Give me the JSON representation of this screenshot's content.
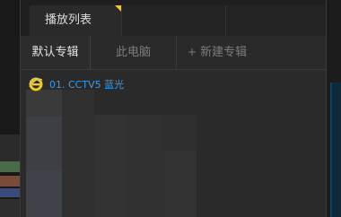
{
  "header": {
    "tab_label": "播放列表"
  },
  "subtabs": {
    "default_album": "默认专辑",
    "this_computer": "此电脑",
    "new_album_plus": "+",
    "new_album": "新建专辑"
  },
  "playlist": {
    "items": [
      {
        "label": "01. CCTV5 蓝光",
        "icon": "ie-icon"
      }
    ]
  },
  "colors": {
    "accent_link": "#3d9ae6",
    "tab_corner": "#e8c44a"
  }
}
